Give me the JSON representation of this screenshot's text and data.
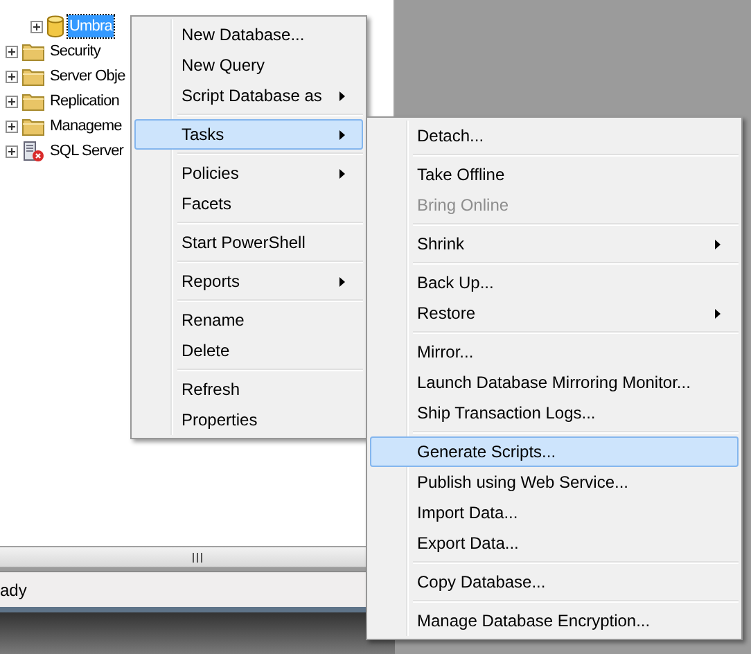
{
  "tree": {
    "items": [
      {
        "label": "Umbra",
        "kind": "database",
        "selected": true,
        "indent": true
      },
      {
        "label": "Security",
        "kind": "folder",
        "selected": false,
        "indent": false
      },
      {
        "label": "Server Obje",
        "kind": "folder",
        "selected": false,
        "indent": false
      },
      {
        "label": "Replication",
        "kind": "folder",
        "selected": false,
        "indent": false
      },
      {
        "label": "Manageme",
        "kind": "folder",
        "selected": false,
        "indent": false
      },
      {
        "label": "SQL Server",
        "kind": "agent",
        "selected": false,
        "indent": false
      }
    ]
  },
  "status_bar": {
    "text": "ady"
  },
  "context_menu": {
    "items": [
      {
        "kind": "item",
        "label": "New Database...",
        "submenu": false,
        "selected": false,
        "disabled": false
      },
      {
        "kind": "item",
        "label": "New Query",
        "submenu": false,
        "selected": false,
        "disabled": false
      },
      {
        "kind": "item",
        "label": "Script Database as",
        "submenu": true,
        "selected": false,
        "disabled": false
      },
      {
        "kind": "separator"
      },
      {
        "kind": "item",
        "label": "Tasks",
        "submenu": true,
        "selected": true,
        "disabled": false
      },
      {
        "kind": "separator"
      },
      {
        "kind": "item",
        "label": "Policies",
        "submenu": true,
        "selected": false,
        "disabled": false
      },
      {
        "kind": "item",
        "label": "Facets",
        "submenu": false,
        "selected": false,
        "disabled": false
      },
      {
        "kind": "separator"
      },
      {
        "kind": "item",
        "label": "Start PowerShell",
        "submenu": false,
        "selected": false,
        "disabled": false
      },
      {
        "kind": "separator"
      },
      {
        "kind": "item",
        "label": "Reports",
        "submenu": true,
        "selected": false,
        "disabled": false
      },
      {
        "kind": "separator"
      },
      {
        "kind": "item",
        "label": "Rename",
        "submenu": false,
        "selected": false,
        "disabled": false
      },
      {
        "kind": "item",
        "label": "Delete",
        "submenu": false,
        "selected": false,
        "disabled": false
      },
      {
        "kind": "separator"
      },
      {
        "kind": "item",
        "label": "Refresh",
        "submenu": false,
        "selected": false,
        "disabled": false
      },
      {
        "kind": "item",
        "label": "Properties",
        "submenu": false,
        "selected": false,
        "disabled": false
      }
    ]
  },
  "tasks_submenu": {
    "items": [
      {
        "kind": "item",
        "label": "Detach...",
        "submenu": false,
        "selected": false,
        "disabled": false
      },
      {
        "kind": "separator"
      },
      {
        "kind": "item",
        "label": "Take Offline",
        "submenu": false,
        "selected": false,
        "disabled": false
      },
      {
        "kind": "item",
        "label": "Bring Online",
        "submenu": false,
        "selected": false,
        "disabled": true
      },
      {
        "kind": "separator"
      },
      {
        "kind": "item",
        "label": "Shrink",
        "submenu": true,
        "selected": false,
        "disabled": false
      },
      {
        "kind": "separator"
      },
      {
        "kind": "item",
        "label": "Back Up...",
        "submenu": false,
        "selected": false,
        "disabled": false
      },
      {
        "kind": "item",
        "label": "Restore",
        "submenu": true,
        "selected": false,
        "disabled": false
      },
      {
        "kind": "separator"
      },
      {
        "kind": "item",
        "label": "Mirror...",
        "submenu": false,
        "selected": false,
        "disabled": false
      },
      {
        "kind": "item",
        "label": "Launch Database Mirroring Monitor...",
        "submenu": false,
        "selected": false,
        "disabled": false
      },
      {
        "kind": "item",
        "label": "Ship Transaction Logs...",
        "submenu": false,
        "selected": false,
        "disabled": false
      },
      {
        "kind": "separator"
      },
      {
        "kind": "item",
        "label": "Generate Scripts...",
        "submenu": false,
        "selected": true,
        "disabled": false
      },
      {
        "kind": "item",
        "label": "Publish using Web Service...",
        "submenu": false,
        "selected": false,
        "disabled": false
      },
      {
        "kind": "item",
        "label": "Import Data...",
        "submenu": false,
        "selected": false,
        "disabled": false
      },
      {
        "kind": "item",
        "label": "Export Data...",
        "submenu": false,
        "selected": false,
        "disabled": false
      },
      {
        "kind": "separator"
      },
      {
        "kind": "item",
        "label": "Copy Database...",
        "submenu": false,
        "selected": false,
        "disabled": false
      },
      {
        "kind": "separator"
      },
      {
        "kind": "item",
        "label": "Manage Database Encryption...",
        "submenu": false,
        "selected": false,
        "disabled": false
      }
    ]
  }
}
